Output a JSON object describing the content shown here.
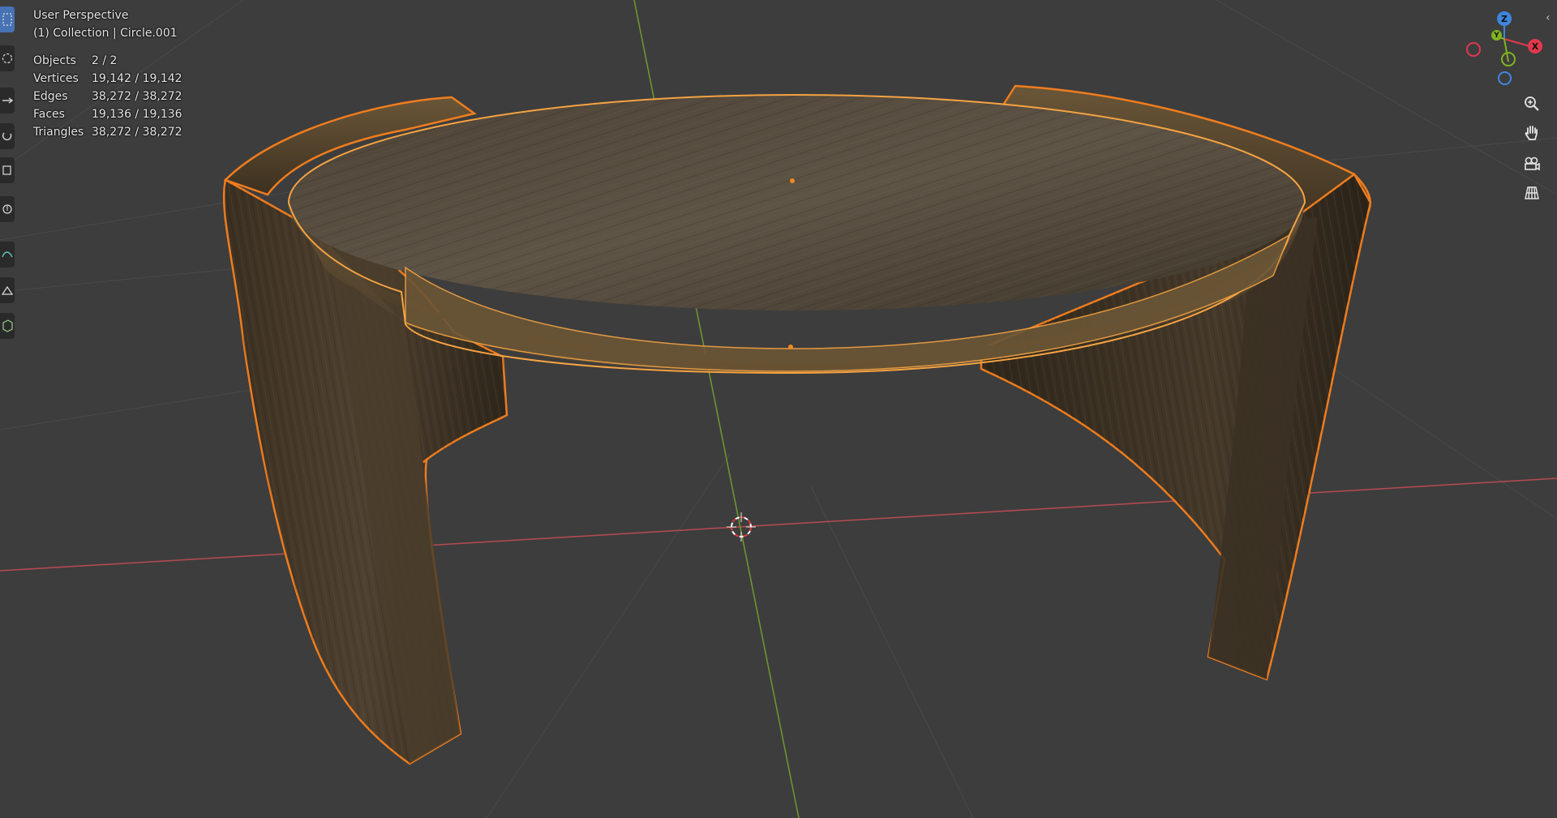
{
  "app": "Blender",
  "viewport": {
    "view_name": "User Perspective",
    "collection_label": "(1) Collection | Circle.001",
    "stats": [
      {
        "label": "Objects",
        "value": "2 / 2"
      },
      {
        "label": "Vertices",
        "value": "19,142 / 19,142"
      },
      {
        "label": "Edges",
        "value": "38,272 / 38,272"
      },
      {
        "label": "Faces",
        "value": "19,136 / 19,136"
      },
      {
        "label": "Triangles",
        "value": "38,272 / 38,272"
      }
    ]
  },
  "gizmo": {
    "z_label": "Z",
    "y_label": "Y",
    "x_label": "X",
    "colors": {
      "x": "#e0394d",
      "y": "#7fb51f",
      "z": "#3f86dc"
    }
  },
  "toolbar": {
    "tools": [
      "select-box-icon",
      "cursor-icon",
      "move-icon",
      "rotate-icon",
      "scale-icon",
      "transform-icon",
      "annotate-icon",
      "measure-icon",
      "add-cube-icon"
    ],
    "active_tool": "select-box-icon"
  },
  "nav_buttons": [
    "zoom-icon",
    "pan-hand-icon",
    "camera-icon",
    "grid-perspective-icon"
  ],
  "colors": {
    "background": "#3d3d3d",
    "selection_outline": "#f07d1e",
    "active_outline": "#f5a343",
    "x_axis_line": "#b94a52",
    "y_axis_line": "#6f9a2d",
    "wood_dark": "#3a2f22",
    "wood_light": "#6b5c44"
  }
}
